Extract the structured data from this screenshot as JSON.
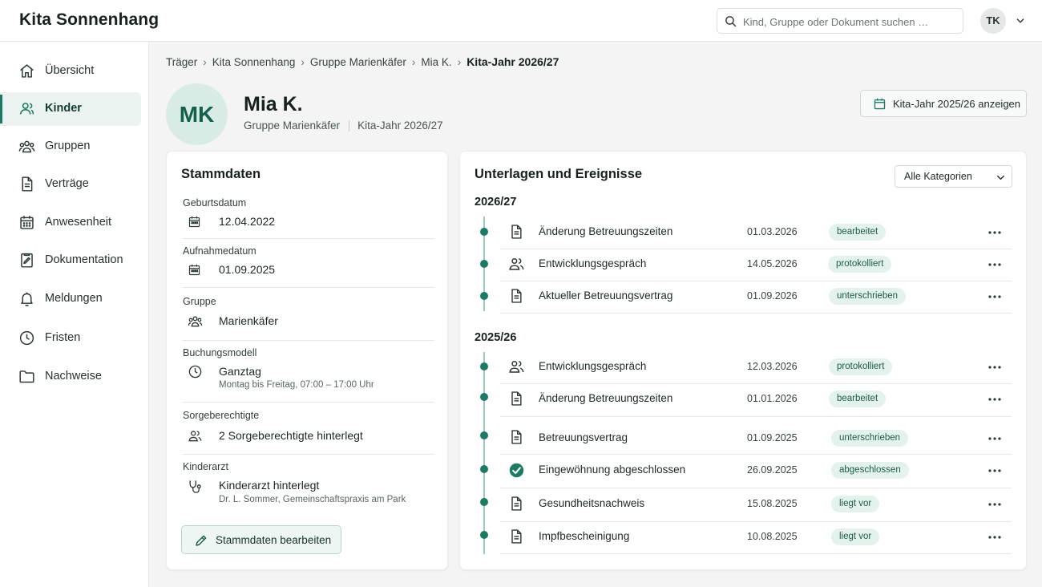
{
  "app": {
    "title": "Kita Sonnenhang"
  },
  "search": {
    "placeholder": "Kind, Gruppe oder Dokument suchen …"
  },
  "user": {
    "initials": "TK"
  },
  "sidebar": {
    "items": [
      {
        "label": "Übersicht",
        "icon": "home-icon"
      },
      {
        "label": "Kinder",
        "icon": "child-icon",
        "active": true
      },
      {
        "label": "Gruppen",
        "icon": "group-icon"
      },
      {
        "label": "Verträge",
        "icon": "document-icon"
      },
      {
        "label": "Anwesenheit",
        "icon": "calendar-icon"
      },
      {
        "label": "Dokumentation",
        "icon": "clipboard-icon"
      },
      {
        "label": "Meldungen",
        "icon": "bell-icon"
      },
      {
        "label": "Fristen",
        "icon": "clock-icon"
      },
      {
        "label": "Nachweise",
        "icon": "folder-icon"
      }
    ]
  },
  "breadcrumb": [
    "Träger",
    "Kita Sonnenhang",
    "Gruppe Marienkäfer",
    "Mia K.",
    "Kita-Jahr 2026/27"
  ],
  "profile": {
    "initials": "MK",
    "name": "Mia K.",
    "group": "Gruppe Marienkäfer",
    "year": "Kita-Jahr 2026/27",
    "other_year_button": "Kita-Jahr 2025/26 anzeigen"
  },
  "stammdaten": {
    "title": "Stammdaten",
    "fields": [
      {
        "label": "Geburtsdatum",
        "value": "12.04.2022",
        "icon": "calendar-icon"
      },
      {
        "label": "Aufnahmedatum",
        "value": "01.09.2025",
        "icon": "calendar-icon"
      },
      {
        "label": "Gruppe",
        "value": "Marienkäfer",
        "icon": "group-icon"
      },
      {
        "label": "Buchungsmodell",
        "value": "Ganztag",
        "sub": "Montag bis Freitag, 07:00 – 17:00 Uhr",
        "icon": "clock-icon"
      },
      {
        "label": "Sorgeberechtigte",
        "value": "2 Sorgeberechtigte hinterlegt",
        "icon": "group-icon"
      },
      {
        "label": "Kinderarzt",
        "value": "Kinderarzt hinterlegt",
        "sub": "Dr. L. Sommer, Gemeinschaftspraxis am Park",
        "icon": "stethoscope-icon"
      }
    ],
    "edit_button": "Stammdaten bearbeiten"
  },
  "events": {
    "title": "Unterlagen und Ereignisse",
    "filter": "Alle Kategorien",
    "groups": [
      {
        "year": "2026/27",
        "items": [
          {
            "title": "Änderung Betreuungszeiten",
            "date": "01.03.2026",
            "status": "bearbeitet",
            "icon": "document-icon"
          },
          {
            "title": "Entwicklungsgespräch",
            "date": "14.05.2026",
            "status": "protokolliert",
            "icon": "people-icon"
          },
          {
            "title": "Aktueller Betreuungsvertrag",
            "date": "01.09.2026",
            "status": "unterschrieben",
            "icon": "document-icon"
          }
        ]
      },
      {
        "year": "2025/26",
        "items": [
          {
            "title": "Entwicklungsgespräch",
            "date": "12.03.2026",
            "status": "protokolliert",
            "icon": "people-icon"
          },
          {
            "title": "Änderung Betreuungszeiten",
            "date": "01.01.2026",
            "status": "bearbeitet",
            "icon": "document-icon"
          },
          {
            "title": "Betreuungsvertrag",
            "date": "01.09.2025",
            "status": "unterschrieben",
            "icon": "document-icon"
          },
          {
            "title": "Eingewöhnung abgeschlossen",
            "date": "26.09.2025",
            "status": "abgeschlossen",
            "icon": "check-circle-icon"
          },
          {
            "title": "Gesundheitsnachweis",
            "date": "15.08.2025",
            "status": "liegt vor",
            "icon": "document-icon"
          },
          {
            "title": "Impfbescheinigung",
            "date": "10.08.2025",
            "status": "liegt vor",
            "icon": "document-icon"
          }
        ]
      }
    ]
  },
  "colors": {
    "accent": "#1e7a63",
    "badge_bg": "#e4f2ec",
    "avatar_bg": "#d8ece5"
  }
}
